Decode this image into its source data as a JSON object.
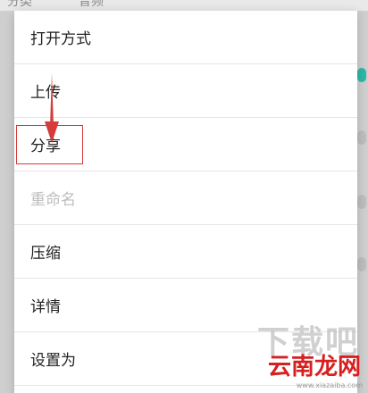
{
  "background": {
    "tabs": [
      "分类",
      "音频"
    ]
  },
  "menu": {
    "items": [
      {
        "label": "打开方式",
        "enabled": true
      },
      {
        "label": "上传",
        "enabled": true
      },
      {
        "label": "分享",
        "enabled": true,
        "highlighted": true
      },
      {
        "label": "重命名",
        "enabled": false
      },
      {
        "label": "压缩",
        "enabled": true
      },
      {
        "label": "详情",
        "enabled": true
      },
      {
        "label": "设置为",
        "enabled": true
      }
    ]
  },
  "annotation": {
    "arrow_color": "#d63a3a",
    "box_color": "#d63a3a"
  },
  "watermark": {
    "big_text": "下载吧",
    "brand": "云南龙网",
    "url": "www.xiazaiba.com"
  }
}
